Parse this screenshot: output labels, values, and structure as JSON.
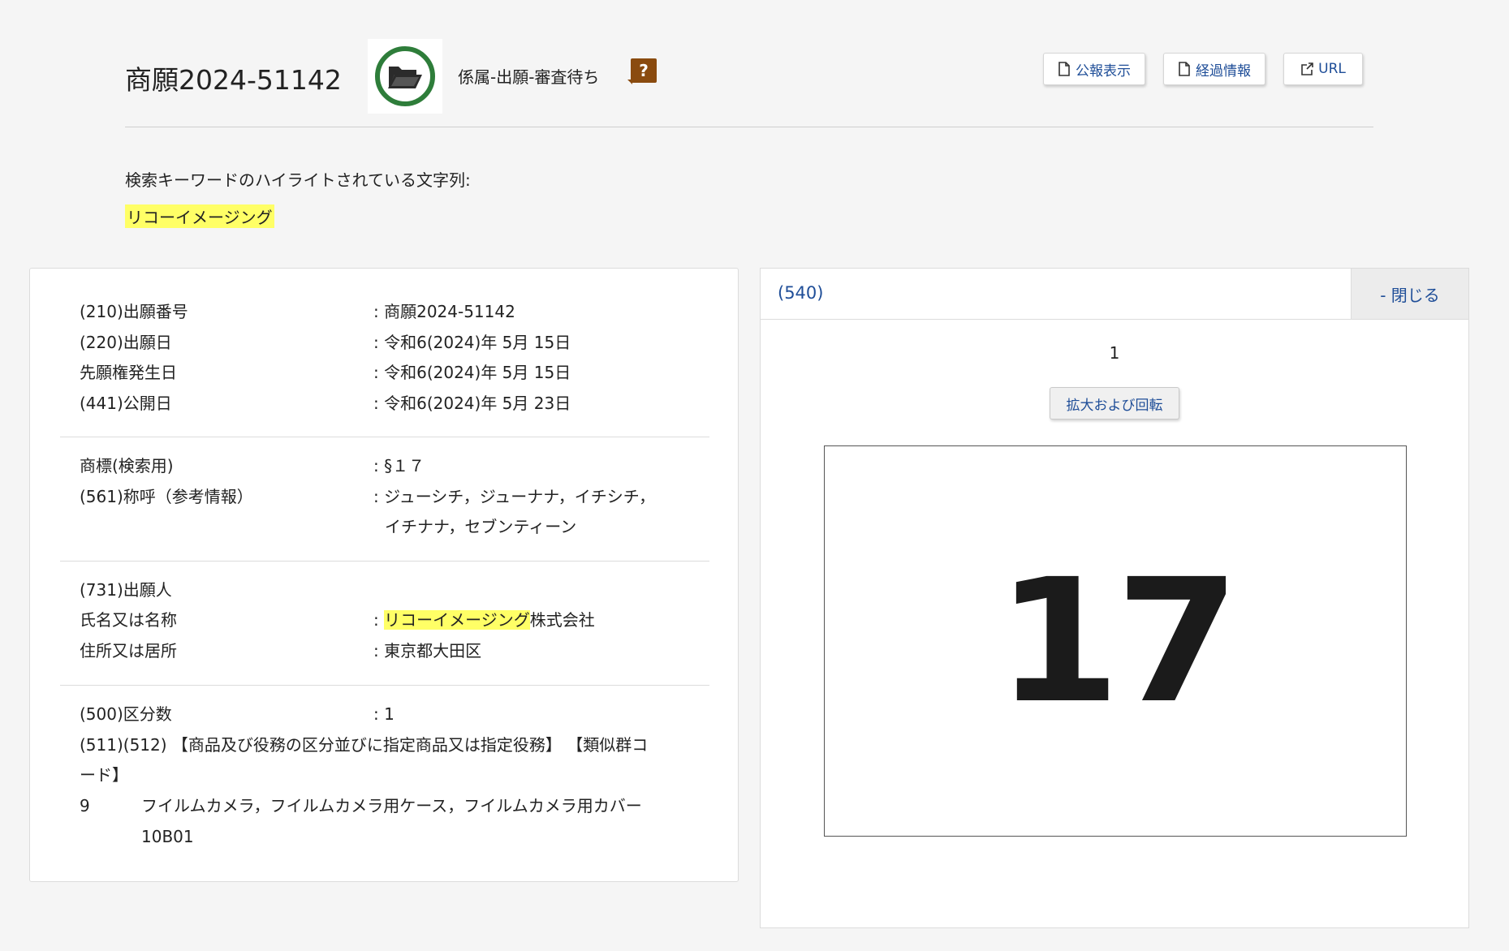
{
  "header": {
    "title": "商願2024-51142",
    "status": "係属-出願-審査待ち",
    "help": "?",
    "buttons": {
      "gazette": "公報表示",
      "history": "経過情報",
      "url": "URL"
    }
  },
  "keywords": {
    "label": "検索キーワードのハイライトされている文字列:",
    "value": "リコーイメージング"
  },
  "details": {
    "s1": [
      {
        "label": "(210)出願番号",
        "value": ": 商願2024-51142"
      },
      {
        "label": "(220)出願日",
        "value": ": 令和6(2024)年 5月 15日"
      },
      {
        "label": "先願権発生日",
        "value": ": 令和6(2024)年 5月 15日"
      },
      {
        "label": "(441)公開日",
        "value": ": 令和6(2024)年 5月 23日"
      }
    ],
    "s2": {
      "mark_label": "商標(検索用)",
      "mark_value": ": §１７",
      "reading_label": "(561)称呼（参考情報）",
      "reading_value_1": ": ジューシチ，ジューナナ，イチシチ，",
      "reading_value_2": "イチナナ，セブンティーン"
    },
    "s3": {
      "applicant_label": "(731)出願人",
      "name_label": "氏名又は名称",
      "name_prefix": ": ",
      "name_hl": "リコーイメージング",
      "name_suffix": "株式会社",
      "address_label": "住所又は居所",
      "address_value": ": 東京都大田区"
    },
    "s4": {
      "class_count_label": "(500)区分数",
      "class_count_value": ": 1",
      "goods_header_1": "(511)(512) 【商品及び役務の区分並びに指定商品又は指定役務】 【類似群コ",
      "goods_header_2": "ード】",
      "class_no": "9",
      "goods": "フイルムカメラ，フイルムカメラ用ケース，フイルムカメラ用カバー",
      "group_code": "10B01"
    }
  },
  "image_panel": {
    "title": "(540)",
    "close": "- 閉じる",
    "index": "1",
    "zoom": "拡大および回転",
    "mark": "17"
  }
}
